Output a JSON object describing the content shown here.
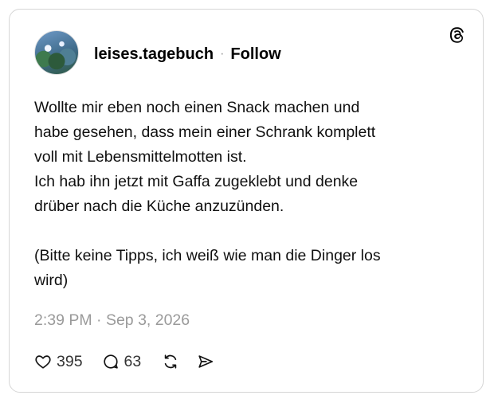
{
  "post": {
    "username": "leises.tagebuch",
    "separator": "·",
    "follow_label": "Follow",
    "body_lines": [
      "Wollte mir eben noch einen Snack machen und",
      "habe gesehen, dass mein einer Schrank komplett",
      "voll mit Lebensmittelmotten ist.",
      "Ich hab ihn jetzt mit Gaffa zugeklebt und denke",
      "drüber nach die Küche anzuzünden."
    ],
    "body_lines_2": [
      "(Bitte keine Tipps, ich weiß wie man die Dinger los",
      "wird)"
    ],
    "timestamp": "2:39 PM · Sep 3, 2026",
    "likes": "395",
    "replies": "63"
  },
  "icons": {
    "brand": "threads-logo-icon",
    "like": "heart-icon",
    "reply": "comment-icon",
    "repost": "repost-icon",
    "share": "send-icon"
  },
  "colors": {
    "border": "#d6d6d6",
    "timestamp": "#9a9a9a"
  }
}
